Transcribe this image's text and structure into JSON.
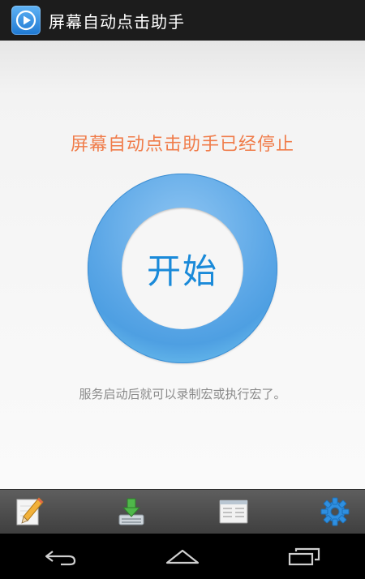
{
  "app": {
    "title": "屏幕自动点击助手",
    "icon": "play-icon"
  },
  "main": {
    "status": "屏幕自动点击助手已经停止",
    "start_label": "开始",
    "hint": "服务启动后就可以录制宏或执行宏了。"
  },
  "toolbar": {
    "items": [
      {
        "icon": "pencil-icon"
      },
      {
        "icon": "download-icon"
      },
      {
        "icon": "window-list-icon"
      },
      {
        "icon": "gear-icon"
      }
    ]
  },
  "navbar": {
    "items": [
      {
        "icon": "back-icon"
      },
      {
        "icon": "home-icon"
      },
      {
        "icon": "recent-apps-icon"
      }
    ]
  },
  "colors": {
    "status_text": "#f07c4a",
    "start_text": "#1a8ad9",
    "ring": "#5aa6e6",
    "hint_text": "#8a8a8a"
  }
}
